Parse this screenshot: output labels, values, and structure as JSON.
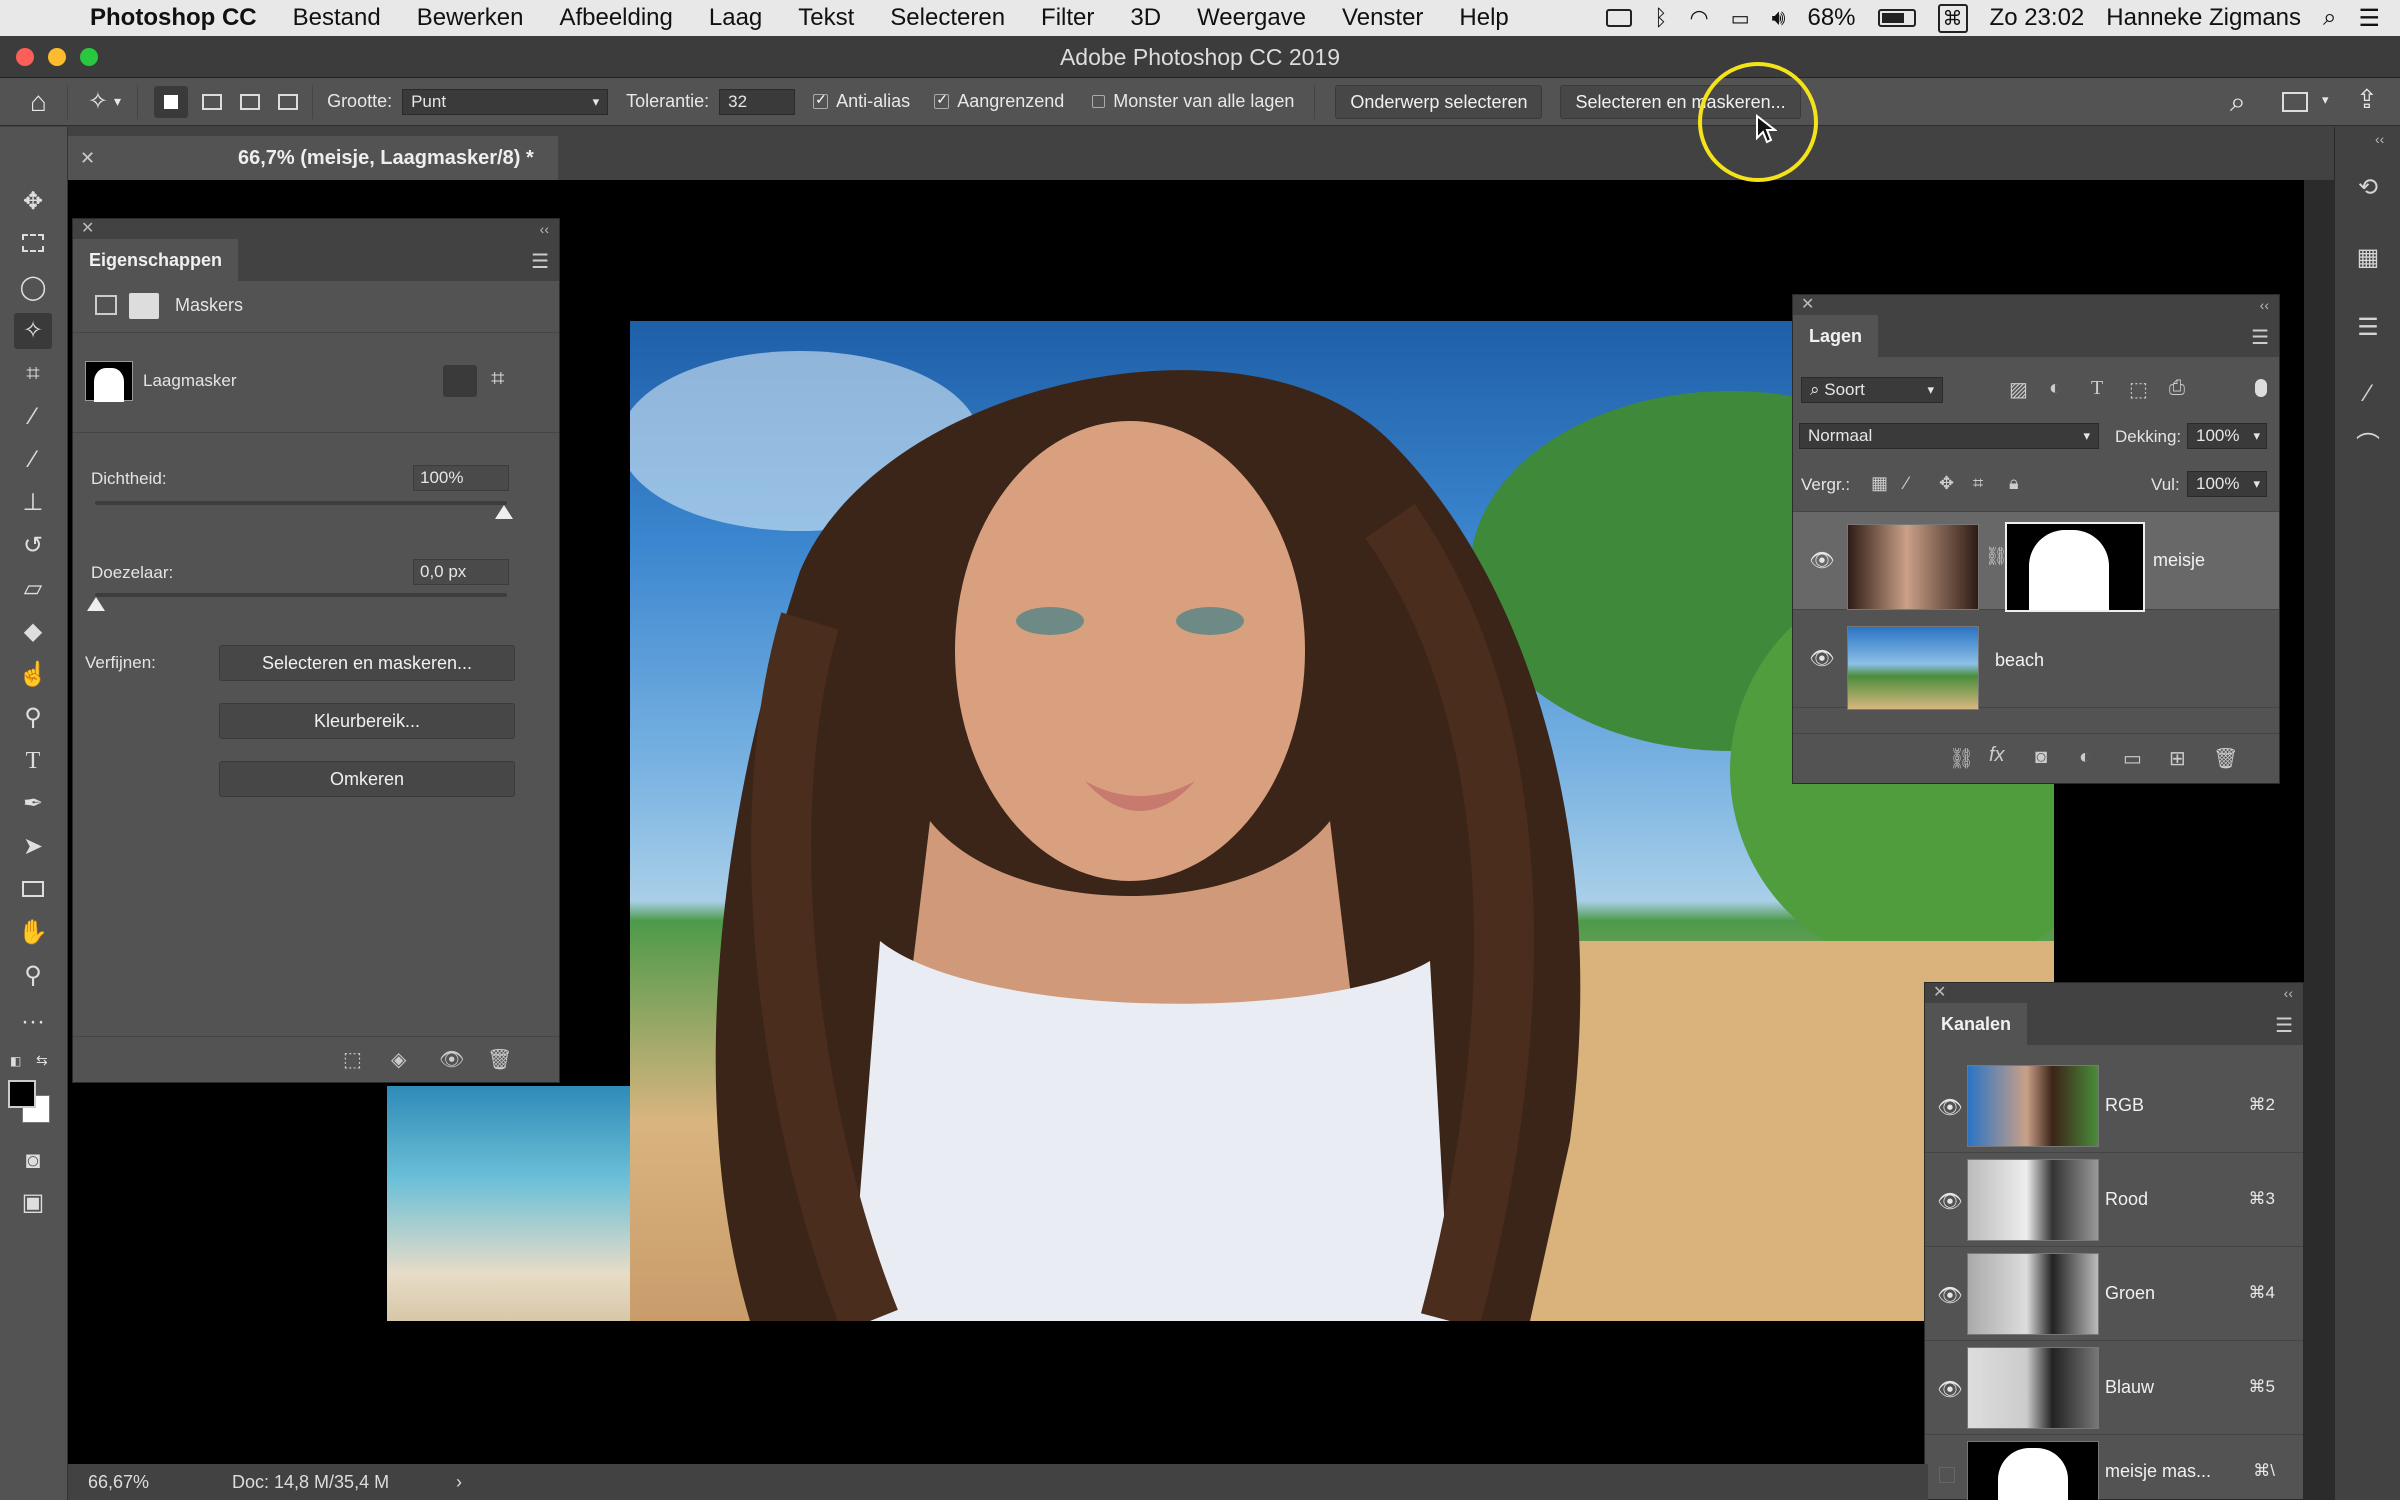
{
  "menubar": {
    "app": "Photoshop CC",
    "items": [
      "Bestand",
      "Bewerken",
      "Afbeelding",
      "Laag",
      "Tekst",
      "Selecteren",
      "Filter",
      "3D",
      "Weergave",
      "Venster",
      "Help"
    ],
    "battery": "68%",
    "clock": "Zo 23:02",
    "user": "Hanneke Zigmans"
  },
  "window": {
    "title": "Adobe Photoshop CC 2019"
  },
  "options": {
    "size_label": "Grootte:",
    "size_value": "Punt",
    "tolerance_label": "Tolerantie:",
    "tolerance_value": "32",
    "antialias_label": "Anti-alias",
    "antialias_checked": true,
    "contiguous_label": "Aangrenzend",
    "contiguous_checked": true,
    "sample_all_label": "Monster van alle lagen",
    "sample_all_checked": false,
    "subject_button": "Onderwerp selecteren",
    "mask_button": "Selecteren en maskeren..."
  },
  "document": {
    "tab_title": "66,7% (meisje, Laagmasker/8) *"
  },
  "properties": {
    "tab": "Eigenschappen",
    "section": "Maskers",
    "mask_type": "Laagmasker",
    "density_label": "Dichtheid:",
    "density_value": "100%",
    "density_level": 1.0,
    "feather_label": "Doezelaar:",
    "feather_value": "0,0 px",
    "feather_level": 0.0,
    "refine_label": "Verfijnen:",
    "buttons": [
      "Selecteren en maskeren...",
      "Kleurbereik...",
      "Omkeren"
    ]
  },
  "layers": {
    "tab": "Lagen",
    "filter": "Soort",
    "blend_mode": "Normaal",
    "opacity_label": "Dekking:",
    "opacity_value": "100%",
    "lock_label": "Vergr.:",
    "fill_label": "Vul:",
    "fill_value": "100%",
    "items": [
      {
        "name": "meisje",
        "visible": true,
        "selected": true
      },
      {
        "name": "beach",
        "visible": true,
        "selected": false
      }
    ]
  },
  "channels": {
    "tab": "Kanalen",
    "items": [
      {
        "name": "RGB",
        "shortcut": "⌘2"
      },
      {
        "name": "Rood",
        "shortcut": "⌘3"
      },
      {
        "name": "Groen",
        "shortcut": "⌘4"
      },
      {
        "name": "Blauw",
        "shortcut": "⌘5"
      },
      {
        "name": "meisje mas...",
        "shortcut": "⌘\\"
      }
    ]
  },
  "status": {
    "zoom": "66,67%",
    "doc": "Doc: 14,8 M/35,4 M"
  },
  "colors": {
    "accent": "#f5e31a",
    "panel": "#535353",
    "canvas": "#000000"
  }
}
